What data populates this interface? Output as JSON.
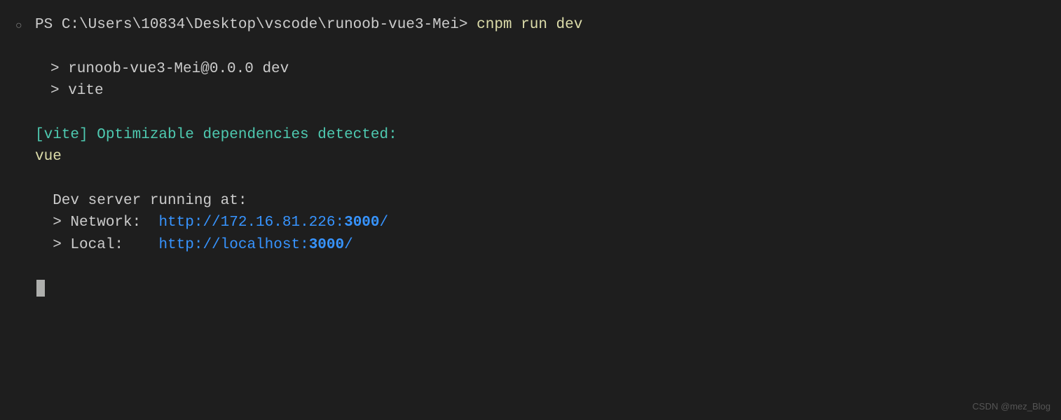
{
  "prompt": {
    "shell": "PS ",
    "path": "C:\\Users\\10834\\Desktop\\vscode\\runoob-vue3-Mei",
    "separator": "> ",
    "command": "cnpm run dev"
  },
  "output": {
    "script_line1": "> runoob-vue3-Mei@0.0.0 dev",
    "script_line2": "> vite",
    "vite_msg": "[vite] Optimizable dependencies detected:",
    "deps": "vue",
    "server_title": "  Dev server running at:",
    "network_label": "  > Network:  ",
    "network_url_prefix": "http://172.16.81.226:",
    "network_port": "3000",
    "network_url_suffix": "/",
    "local_label": "  > Local:    ",
    "local_url_prefix": "http://localhost:",
    "local_port": "3000",
    "local_url_suffix": "/"
  },
  "watermark": "CSDN @mez_Blog"
}
